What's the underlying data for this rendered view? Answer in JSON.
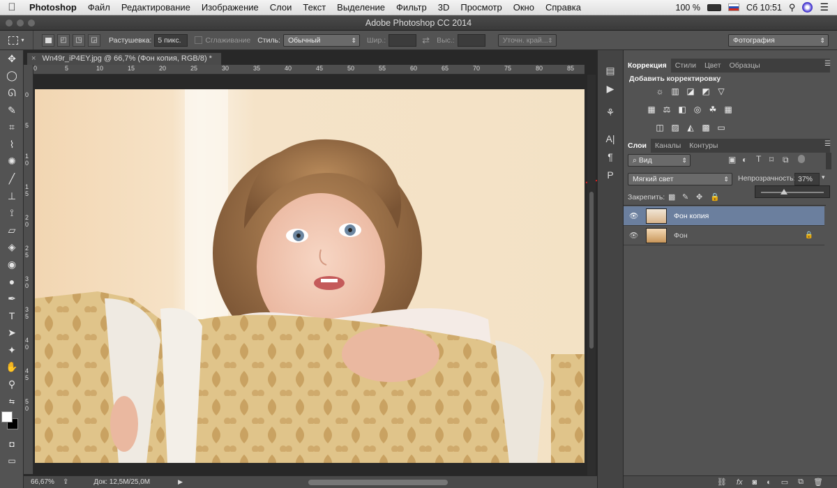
{
  "menubar": {
    "app": "Photoshop",
    "items": [
      "Файл",
      "Редактирование",
      "Изображение",
      "Слои",
      "Текст",
      "Выделение",
      "Фильтр",
      "3D",
      "Просмотр",
      "Окно",
      "Справка"
    ],
    "battery": "100 %",
    "clock": "Сб 10:51"
  },
  "window": {
    "title": "Adobe Photoshop CC 2014"
  },
  "options": {
    "feather_label": "Растушевка:",
    "feather_value": "5 пикс.",
    "antialias_label": "Сглаживание",
    "style_label": "Стиль:",
    "style_value": "Обычный",
    "width_label": "Шир.:",
    "height_label": "Выс.:",
    "refine_edge": "Уточн. край...",
    "workspace": "Фотография"
  },
  "document": {
    "tab_title": "Wn49r_iP4EY.jpg @ 66,7% (Фон копия, RGB/8) *",
    "ruler_h": [
      "0",
      "5",
      "10",
      "15",
      "20",
      "25",
      "30",
      "35",
      "40",
      "45",
      "50",
      "55",
      "60",
      "65",
      "70",
      "75",
      "80",
      "85"
    ],
    "ruler_v": [
      "0",
      "5",
      "1 0",
      "1 5",
      "2 0",
      "2 5",
      "3 0",
      "3 5",
      "4 0",
      "4 5",
      "5 0"
    ],
    "zoom": "66,67%",
    "doc_info": "Док: 12,5M/25,0M"
  },
  "adjustments": {
    "tabs": [
      "Коррекция",
      "Стили",
      "Цвет",
      "Образцы"
    ],
    "heading": "Добавить корректировку"
  },
  "layers": {
    "tabs": [
      "Слои",
      "Каналы",
      "Контуры"
    ],
    "filter_kind": "Вид",
    "blend_mode": "Мягкий свет",
    "opacity_label": "Непрозрачность:",
    "opacity_value": "37%",
    "opacity_fraction": 0.37,
    "lock_label": "Закрепить:",
    "rows": [
      {
        "name": "Фон копия",
        "selected": true,
        "locked": false
      },
      {
        "name": "Фон",
        "selected": false,
        "locked": true
      }
    ],
    "footer_icons": [
      "link-icon",
      "fx-icon",
      "mask-icon",
      "adjustment-icon",
      "folder-icon",
      "new-layer-icon",
      "trash-icon"
    ]
  },
  "colors": {
    "selection": "#6b7f9e",
    "annotation": "#e01e1e"
  }
}
